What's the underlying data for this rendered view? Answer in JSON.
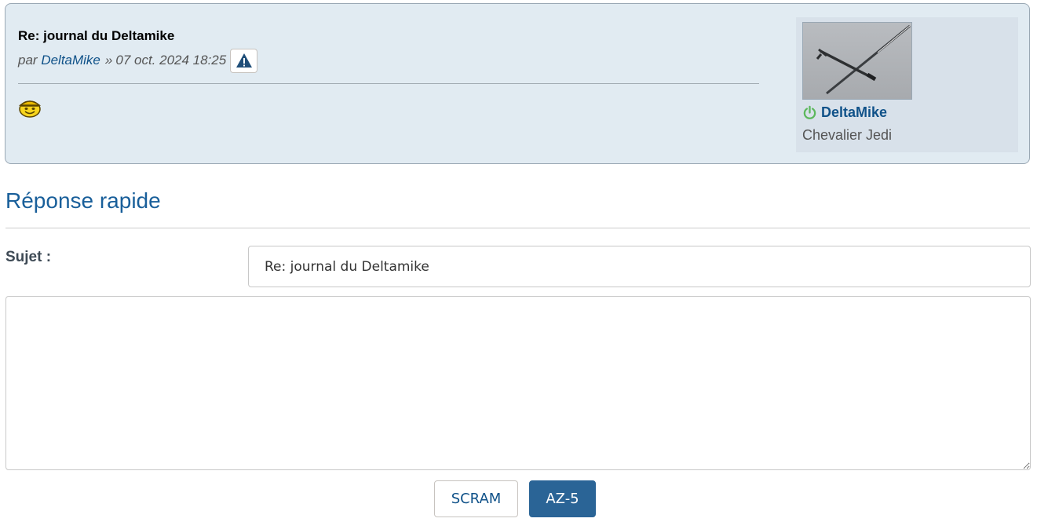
{
  "post": {
    "title": "Re: journal du Deltamike",
    "by_prefix": "par",
    "author": "DeltaMike",
    "separator": "»",
    "date": "07 oct. 2024 18:25",
    "report_icon": "warning-triangle-icon",
    "content_icon": "smiley-cap-icon"
  },
  "profile": {
    "avatar": "glider-avatar",
    "status_icon": "online-power-icon",
    "name": "DeltaMike",
    "rank": "Chevalier Jedi"
  },
  "quick_reply": {
    "heading": "Réponse rapide",
    "subject_label": "Sujet :",
    "subject_value": "Re: journal du Deltamike",
    "message_value": "",
    "secondary_button": "SCRAM",
    "primary_button": "AZ-5"
  },
  "colors": {
    "post_bg": "#e1ebf2",
    "profile_bg": "#d8e1ea",
    "link": "#105289",
    "heading": "#195f9a",
    "primary_button": "#2a6496",
    "online": "#5cb85c"
  }
}
